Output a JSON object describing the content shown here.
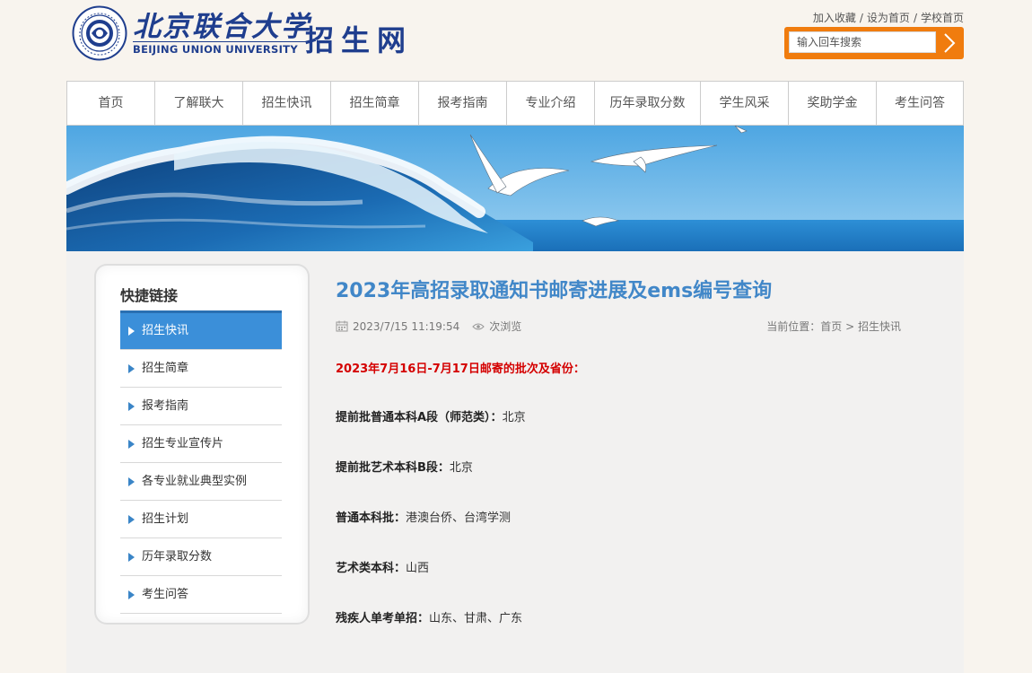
{
  "header": {
    "school_name_cn": "北京联合大学",
    "school_name_en": "BEIJING UNION UNIVERSITY",
    "site_title": "招生网",
    "links": [
      "加入收藏",
      "设为首页",
      "学校首页"
    ],
    "search_placeholder": "输入回车搜索"
  },
  "nav": [
    "首页",
    "了解联大",
    "招生快讯",
    "招生简章",
    "报考指南",
    "专业介绍",
    "历年录取分数",
    "学生风采",
    "奖助学金",
    "考生问答"
  ],
  "sidebar": {
    "title": "快捷链接",
    "items": [
      "招生快讯",
      "招生简章",
      "报考指南",
      "招生专业宣传片",
      "各专业就业典型实例",
      "招生计划",
      "历年录取分数",
      "考生问答"
    ],
    "active_index": 0
  },
  "article": {
    "title": "2023年高招录取通知书邮寄进展及ems编号查询",
    "datetime": "2023/7/15 11:19:54",
    "views": "次浏览",
    "breadcrumb_prefix": "当前位置：",
    "breadcrumb": [
      "首页",
      "招生快讯"
    ],
    "intro": "2023年7月16日-7月17日邮寄的批次及省份：",
    "entries": [
      {
        "label": "提前批普通本科A段（师范类）：",
        "value": "北京"
      },
      {
        "label": "提前批艺术本科B段：",
        "value": "北京"
      },
      {
        "label": "普通本科批：",
        "value": "港澳台侨、台湾学测"
      },
      {
        "label": "艺术类本科：",
        "value": "山西"
      },
      {
        "label": "残疾人单考单招：",
        "value": "山东、甘肃、广东"
      }
    ]
  },
  "colors": {
    "brand_blue": "#1f3e8e",
    "accent_orange": "#f07c0e",
    "title_blue": "#4187c8",
    "active_blue": "#3b8fd9",
    "intro_red": "#d40000"
  }
}
